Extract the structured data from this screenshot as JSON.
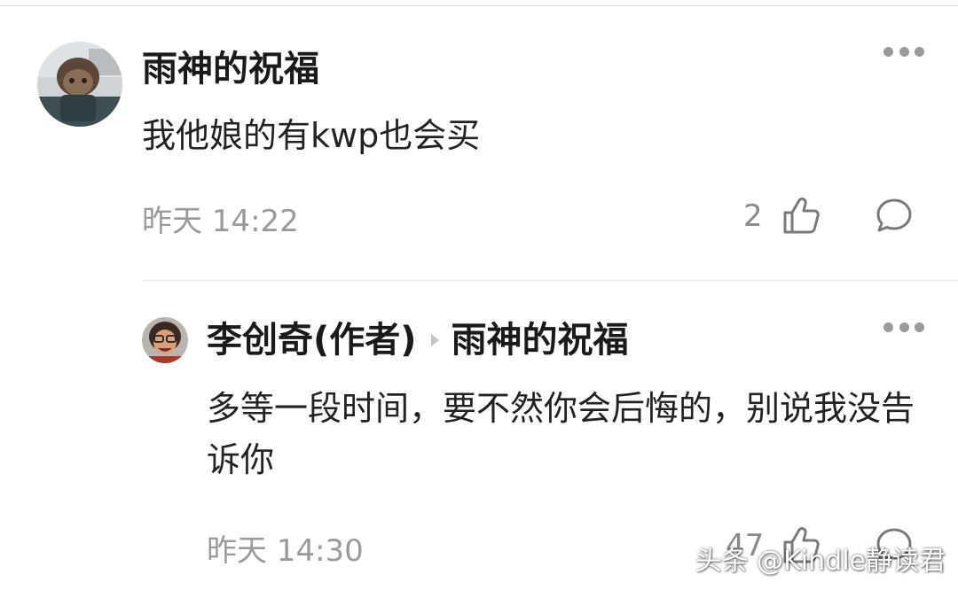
{
  "comment": {
    "author": "雨神的祝福",
    "text": "我他娘的有kwp也会买",
    "time": "昨天 14:22",
    "likes": "2",
    "avatar_icon": "user-avatar-photo"
  },
  "reply": {
    "author": "李创奇(作者)",
    "reply_to": "雨神的祝福",
    "text": "多等一段时间，要不然你会后悔的，别说我没告诉你",
    "time": "昨天 14:30",
    "likes": "47",
    "avatar_icon": "author-avatar-photo"
  },
  "icons": {
    "like": "thumbs-up-icon",
    "reply": "comment-bubble-icon",
    "more": "more-dots-icon"
  },
  "watermark": "头条 @Kindle静读君",
  "colors": {
    "meta_gray": "#9a9a9a",
    "name_black": "#1a1a1a",
    "divider": "#e6e6e6"
  }
}
